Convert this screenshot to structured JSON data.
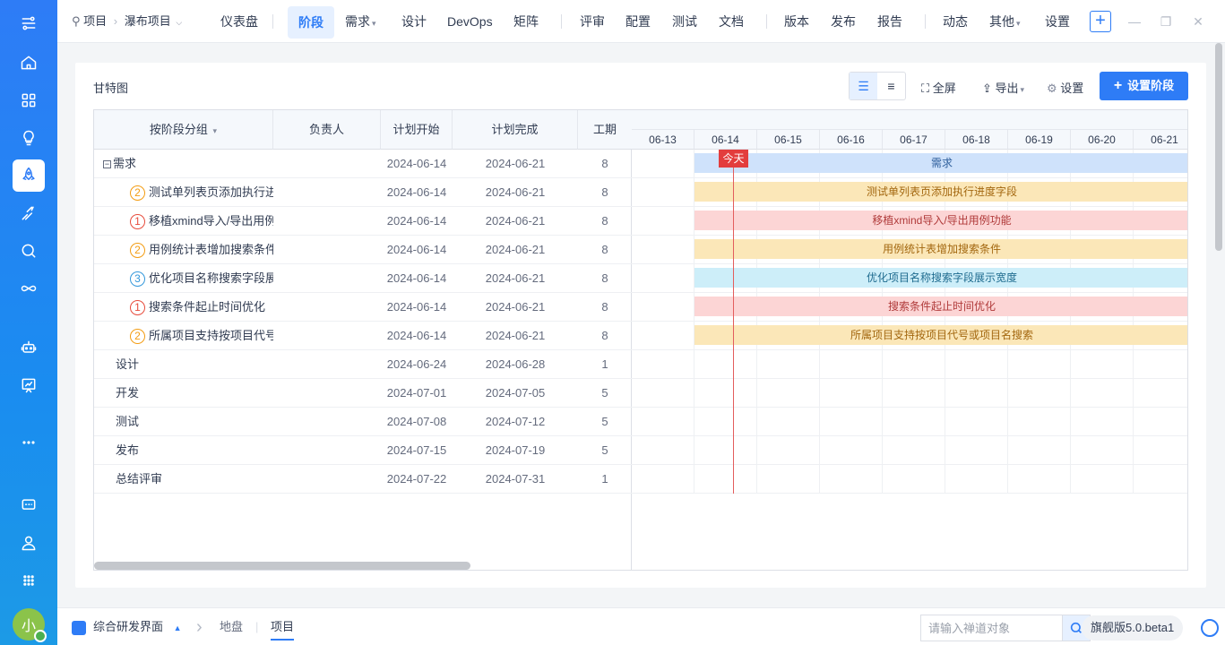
{
  "sidebar": {
    "items": [
      {
        "name": "workflow-icon"
      },
      {
        "name": "home-icon"
      },
      {
        "name": "grid-icon"
      },
      {
        "name": "bulb-icon"
      },
      {
        "name": "rocket-icon",
        "active": true
      },
      {
        "name": "runner-icon"
      },
      {
        "name": "qa-search-icon"
      },
      {
        "name": "infinity-icon"
      },
      {
        "name": "robot-icon"
      },
      {
        "name": "report-icon"
      },
      {
        "name": "more-icon"
      },
      {
        "name": "chat-icon"
      },
      {
        "name": "user-icon"
      },
      {
        "name": "apps-icon"
      }
    ],
    "avatar": "小"
  },
  "topbar": {
    "project_label": "项目",
    "project_name": "瀑布项目",
    "nav": [
      "仪表盘",
      "阶段",
      "需求",
      "设计",
      "DevOps",
      "矩阵",
      "评审",
      "配置",
      "测试",
      "文档",
      "版本",
      "发布",
      "报告",
      "动态",
      "其他",
      "设置"
    ],
    "active": "阶段",
    "plus": "+"
  },
  "panel": {
    "title": "甘特图",
    "fullscreen": "全屏",
    "export": "导出",
    "settings": "设置",
    "set_phase": "设置阶段"
  },
  "table": {
    "headers": {
      "group": "按阶段分组",
      "owner": "负责人",
      "start": "计划开始",
      "end": "计划完成",
      "duration": "工期"
    },
    "rows": [
      {
        "name": "需求",
        "level": 0,
        "collapsed": false,
        "start": "2024-06-14",
        "end": "2024-06-21",
        "duration": "8"
      },
      {
        "name": "测试单列表页添加执行进",
        "level": 1,
        "priority": "2",
        "start": "2024-06-14",
        "end": "2024-06-21",
        "duration": "8"
      },
      {
        "name": "移植xmind导入/导出用例",
        "level": 1,
        "priority": "1",
        "start": "2024-06-14",
        "end": "2024-06-21",
        "duration": "8"
      },
      {
        "name": "用例统计表增加搜索条件",
        "level": 1,
        "priority": "2",
        "start": "2024-06-14",
        "end": "2024-06-21",
        "duration": "8"
      },
      {
        "name": "优化项目名称搜索字段展",
        "level": 1,
        "priority": "3",
        "start": "2024-06-14",
        "end": "2024-06-21",
        "duration": "8"
      },
      {
        "name": "搜索条件起止时间优化",
        "level": 1,
        "priority": "1",
        "start": "2024-06-14",
        "end": "2024-06-21",
        "duration": "8"
      },
      {
        "name": "所属项目支持按项目代号",
        "level": 1,
        "priority": "2",
        "start": "2024-06-14",
        "end": "2024-06-21",
        "duration": "8"
      },
      {
        "name": "设计",
        "level": 0,
        "start": "2024-06-24",
        "end": "2024-06-28",
        "duration": "1"
      },
      {
        "name": "开发",
        "level": 0,
        "start": "2024-07-01",
        "end": "2024-07-05",
        "duration": "5"
      },
      {
        "name": "测试",
        "level": 0,
        "start": "2024-07-08",
        "end": "2024-07-12",
        "duration": "5"
      },
      {
        "name": "发布",
        "level": 0,
        "start": "2024-07-15",
        "end": "2024-07-19",
        "duration": "5"
      },
      {
        "name": "总结评审",
        "level": 0,
        "start": "2024-07-22",
        "end": "2024-07-31",
        "duration": "1"
      }
    ]
  },
  "gantt": {
    "days": [
      "06-13",
      "06-14",
      "06-15",
      "06-16",
      "06-17",
      "06-18",
      "06-19",
      "06-20",
      "06-21"
    ],
    "today_label": "今天",
    "bars": [
      {
        "label": "需求",
        "color": "#cfe2fb",
        "text": "#2e5f9c"
      },
      {
        "label": "测试单列表页添加执行进度字段",
        "color": "#fbe7b8",
        "text": "#a3670f"
      },
      {
        "label": "移植xmind导入/导出用例功能",
        "color": "#fcd5d5",
        "text": "#b03a3a"
      },
      {
        "label": "用例统计表增加搜索条件",
        "color": "#fbe7b8",
        "text": "#a3670f"
      },
      {
        "label": "优化项目名称搜索字段展示宽度",
        "color": "#cdeef9",
        "text": "#1e6b8f"
      },
      {
        "label": "搜索条件起止时间优化",
        "color": "#fcd5d5",
        "text": "#b03a3a"
      },
      {
        "label": "所属项目支持按项目代号或项目名搜索",
        "color": "#fbe7b8",
        "text": "#a3670f"
      }
    ]
  },
  "bottombar": {
    "workspace": "综合研发界面",
    "crumb_map": "地盘",
    "crumb_project": "项目",
    "search_placeholder": "请输入禅道对象",
    "version": "旗舰版5.0.beta1"
  }
}
